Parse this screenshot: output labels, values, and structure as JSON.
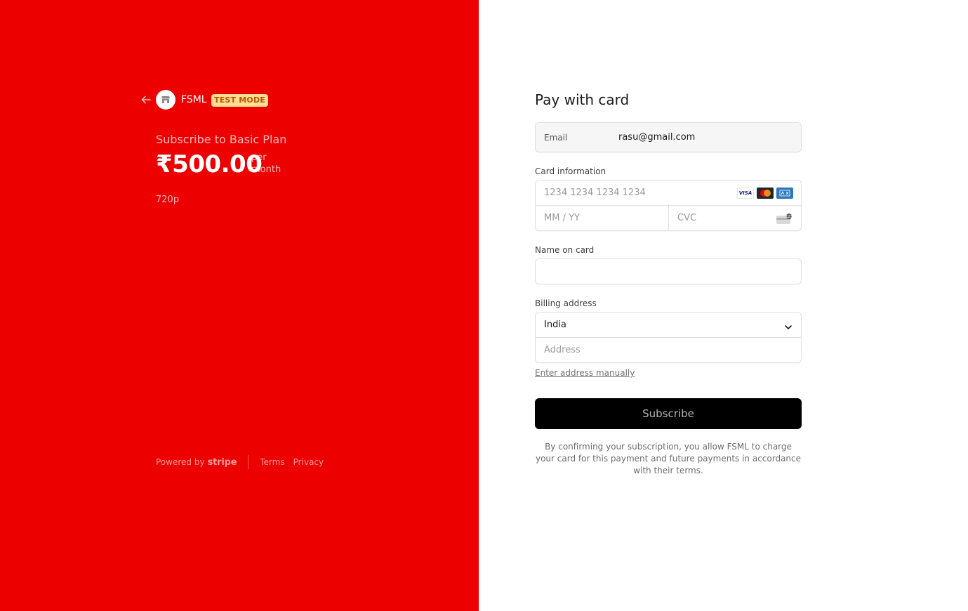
{
  "merchant": {
    "name": "FSML",
    "badge": "TEST MODE",
    "brand_color": "#ec0000"
  },
  "product": {
    "title": "Subscribe to Basic Plan",
    "amount": "₹500.00",
    "interval_line1": "per",
    "interval_line2": "month",
    "description": "720p"
  },
  "footer": {
    "powered_by": "Powered by",
    "stripe": "stripe",
    "terms": "Terms",
    "privacy": "Privacy"
  },
  "form": {
    "title": "Pay with card",
    "email_label": "Email",
    "email_value": "rasu@gmail.com",
    "card_label": "Card information",
    "card_number_placeholder": "1234 1234 1234 1234",
    "expiry_placeholder": "MM / YY",
    "cvc_placeholder": "CVC",
    "card_brands": [
      "VISA",
      "mastercard",
      "AMEX"
    ],
    "name_label": "Name on card",
    "name_value": "",
    "billing_label": "Billing address",
    "country": "India",
    "address_placeholder": "Address",
    "manual_link": "Enter address manually",
    "submit_label": "Subscribe",
    "legal": "By confirming your subscription, you allow FSML to charge your card for this payment and future payments in accordance with their terms."
  }
}
